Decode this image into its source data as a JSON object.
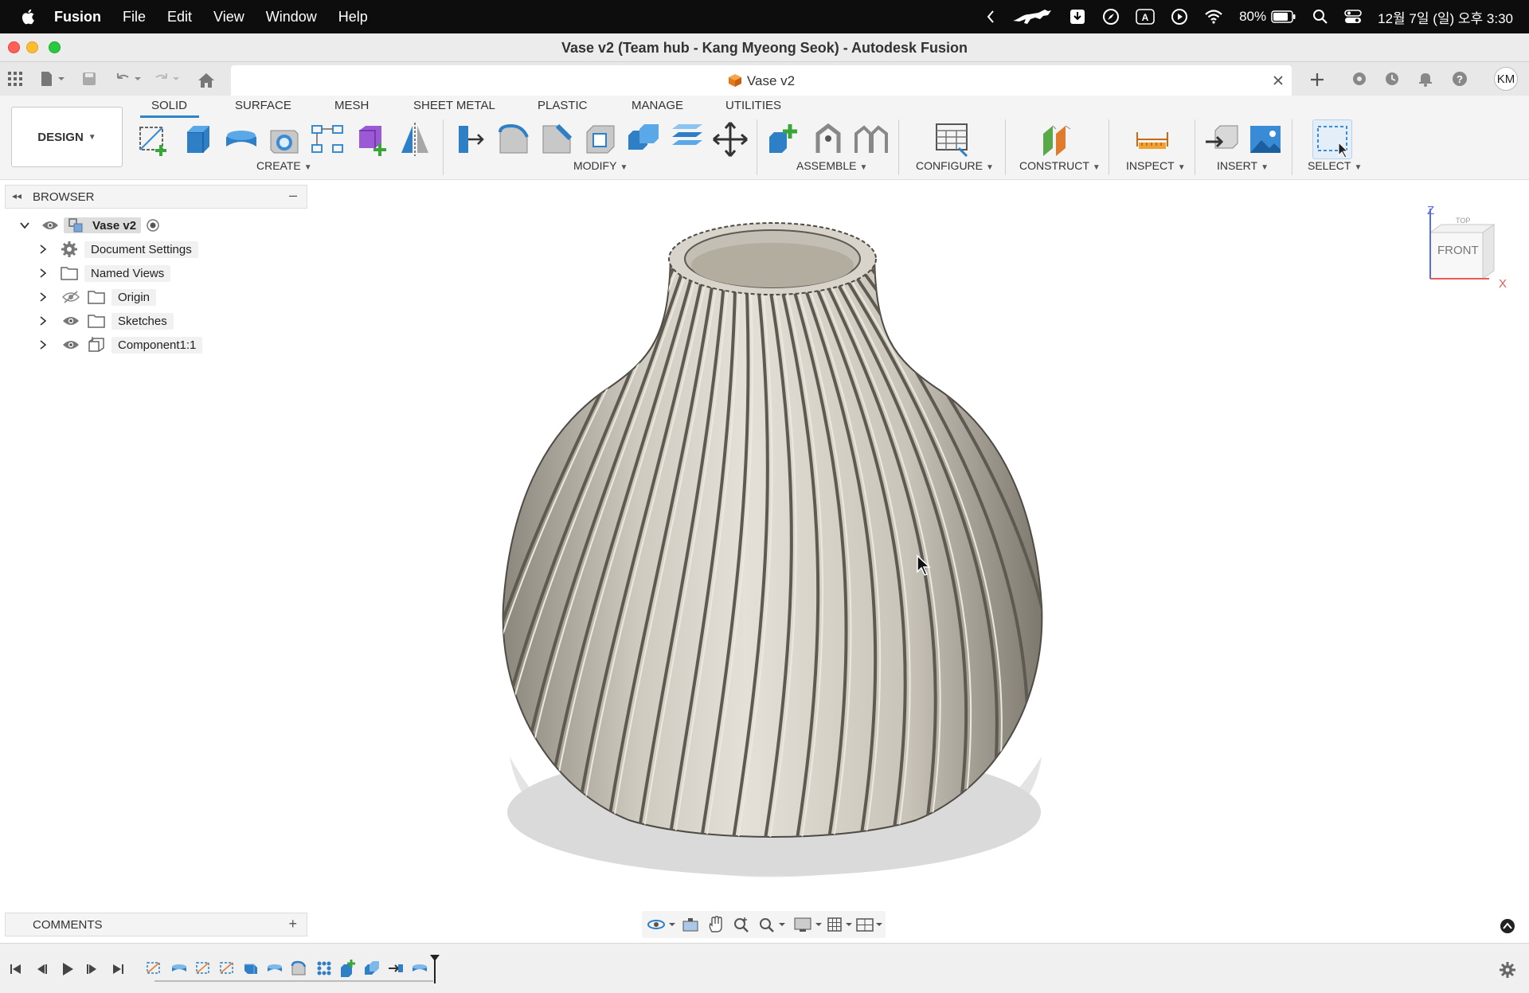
{
  "menubar": {
    "app_name": "Fusion",
    "items": [
      "File",
      "Edit",
      "View",
      "Window",
      "Help"
    ],
    "battery": "80%",
    "datetime": "12월 7일 (일) 오후 3:30"
  },
  "window": {
    "title": "Vase v2 (Team hub - Kang Myeong Seok) - Autodesk Fusion"
  },
  "document_tab": {
    "label": "Vase v2"
  },
  "user": {
    "initials": "KM"
  },
  "toolbar": {
    "workspace": "DESIGN",
    "tabs": [
      "SOLID",
      "SURFACE",
      "MESH",
      "SHEET METAL",
      "PLASTIC",
      "MANAGE",
      "UTILITIES"
    ],
    "active_tab": "SOLID",
    "groups": {
      "create": "CREATE",
      "modify": "MODIFY",
      "assemble": "ASSEMBLE",
      "configure": "CONFIGURE",
      "construct": "CONSTRUCT",
      "inspect": "INSPECT",
      "insert": "INSERT",
      "select": "SELECT"
    }
  },
  "browser": {
    "title": "BROWSER",
    "root": "Vase v2",
    "items": [
      "Document Settings",
      "Named Views",
      "Origin",
      "Sketches",
      "Component1:1"
    ]
  },
  "viewcube": {
    "face": "FRONT",
    "top": "TOP",
    "axis_z": "Z",
    "axis_x": "X"
  },
  "comments": {
    "title": "COMMENTS"
  },
  "colors": {
    "accent": "#2f84c8",
    "model": "#d9d5cc",
    "menubar": "#0d0d0d"
  }
}
